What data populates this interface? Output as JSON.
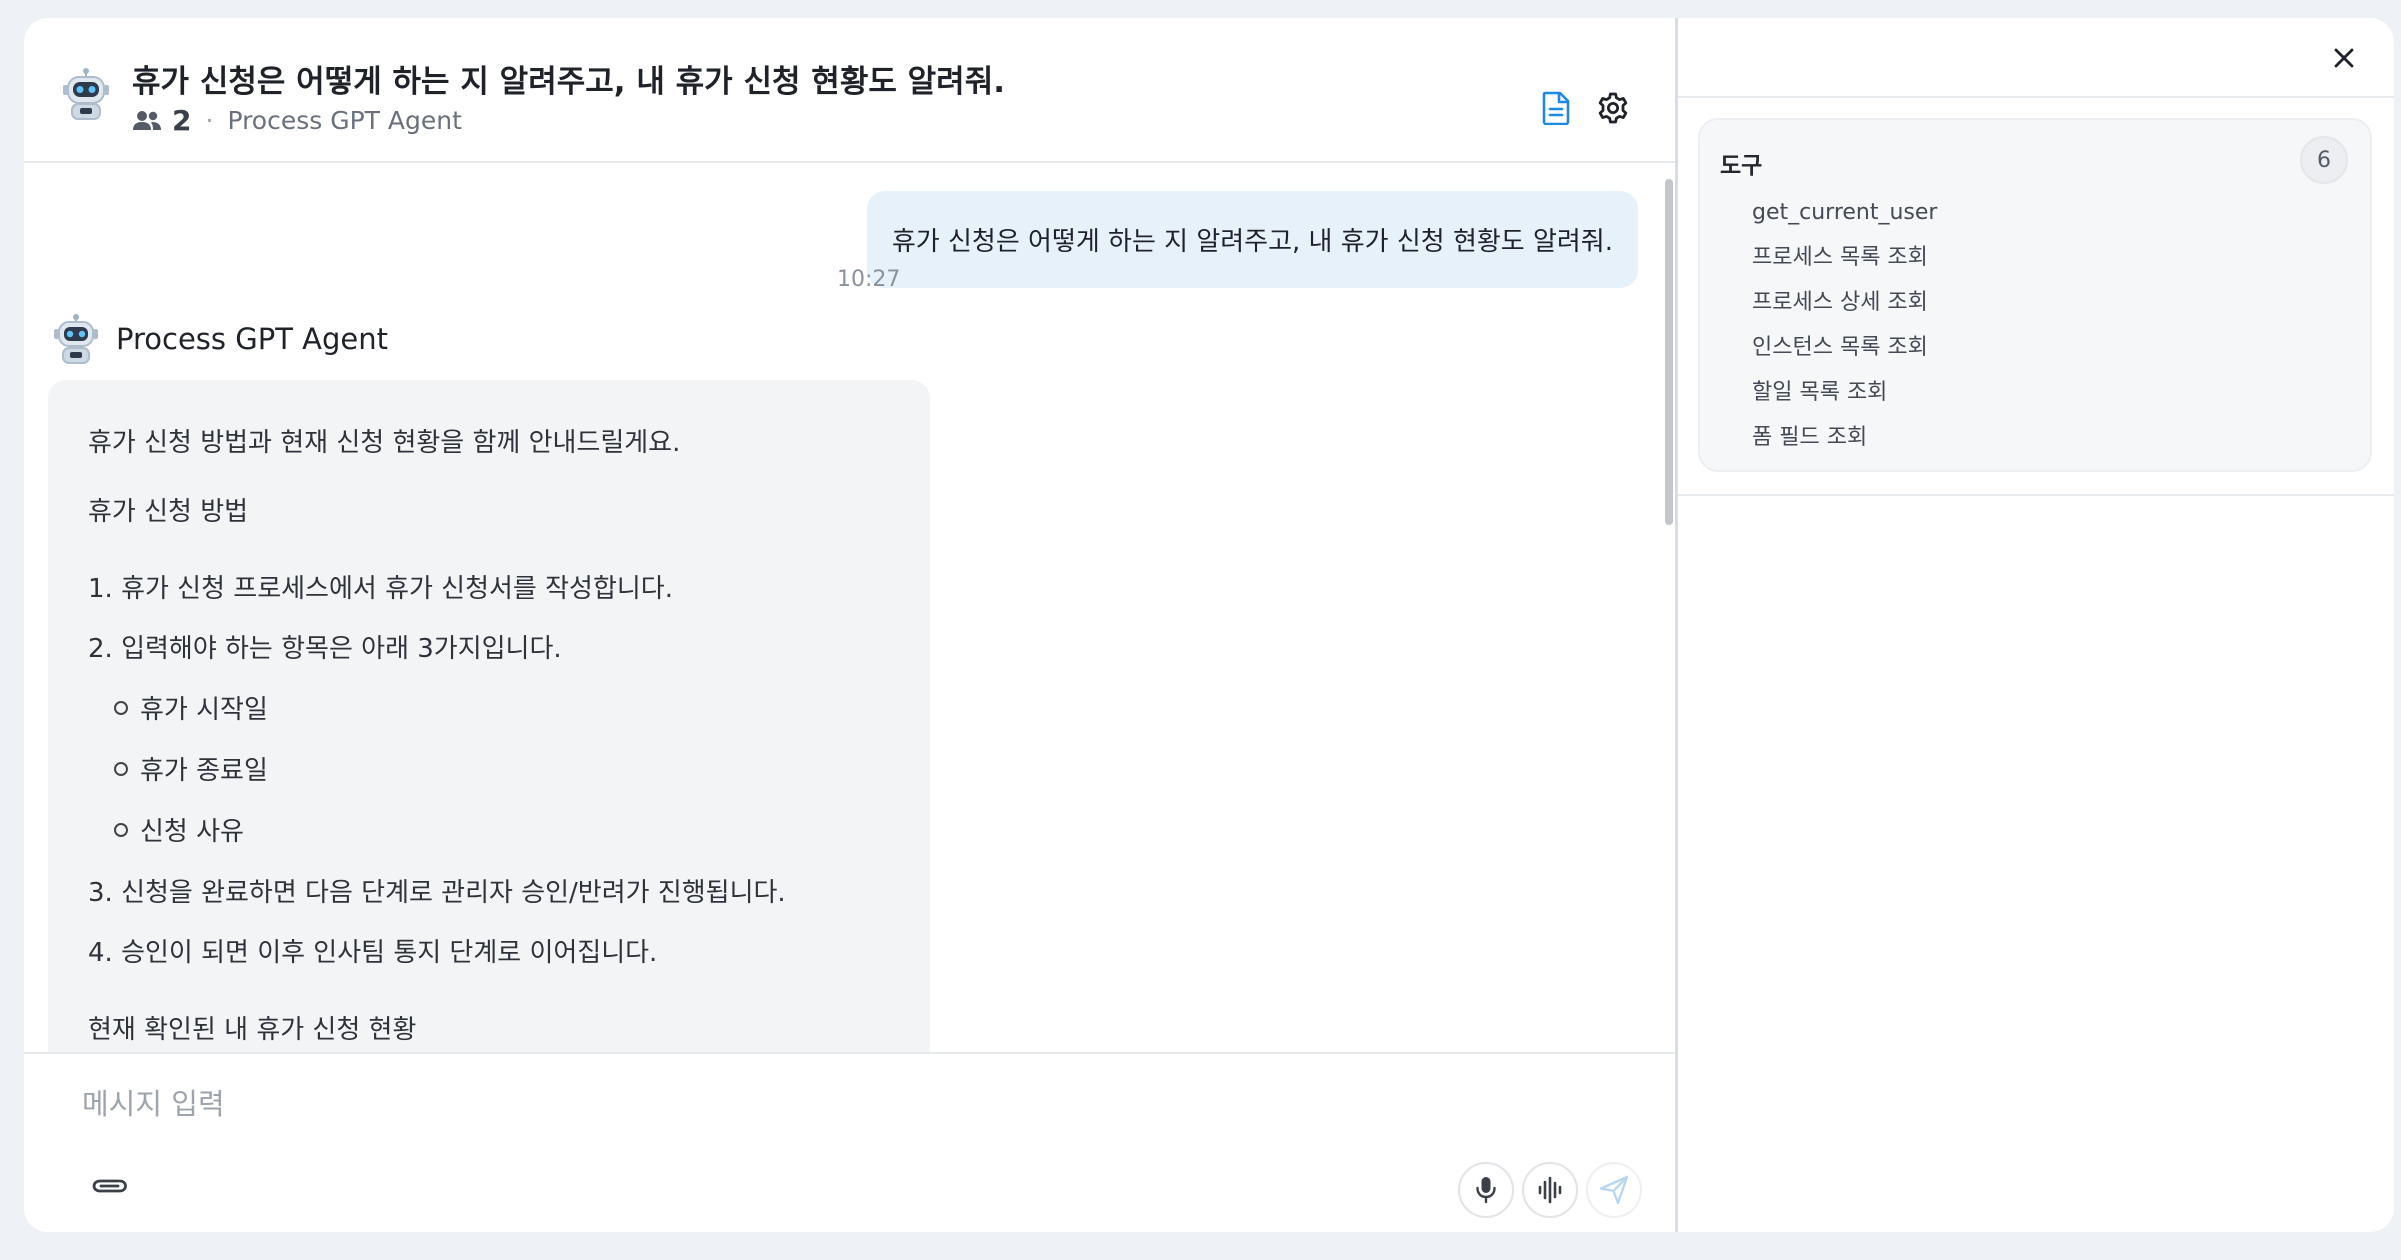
{
  "header": {
    "title": "휴가 신청은 어떻게 하는 지 알려주고, 내 휴가 신청 현황도 알려줘.",
    "member_count": "2",
    "separator": "·",
    "agent_name": "Process GPT Agent"
  },
  "messages": {
    "user": {
      "text": "휴가 신청은 어떻게 하는 지 알려주고, 내 휴가 신청 현황도 알려줘.",
      "time": "10:27"
    },
    "agent": {
      "name": "Process GPT Agent",
      "intro": "휴가 신청 방법과 현재 신청 현황을 함께 안내드릴게요.",
      "section_title": "휴가 신청 방법",
      "steps": [
        "1. 휴가 신청 프로세스에서 휴가 신청서를 작성합니다.",
        "2. 입력해야 하는 항목은 아래 3가지입니다.",
        "3. 신청을 완료하면 다음 단계로 관리자 승인/반려가 진행됩니다.",
        "4. 승인이 되면 이후 인사팀 통지 단계로 이어집니다."
      ],
      "sub_items": [
        "휴가 시작일",
        "휴가 종료일",
        "신청 사유"
      ],
      "status_title": "현재 확인된 내 휴가 신청 현황"
    }
  },
  "input": {
    "placeholder": "메시지 입력"
  },
  "side_panel": {
    "tools_title": "도구",
    "tools_count": "6",
    "tools": [
      "get_current_user",
      "프로세스 목록 조회",
      "프로세스 상세 조회",
      "인스턴스 목록 조회",
      "할일 목록 조회",
      "폼 필드 조회"
    ]
  },
  "colors": {
    "user_bubble": "#e7f1f9",
    "agent_bubble": "#f3f4f6",
    "accent_blue": "#1e88e5",
    "send_icon": "#b9d6f0"
  },
  "icons": [
    "robot-avatar-icon",
    "people-icon",
    "document-icon",
    "gear-icon",
    "paperclip-icon",
    "microphone-icon",
    "waveform-icon",
    "send-icon",
    "close-icon"
  ]
}
